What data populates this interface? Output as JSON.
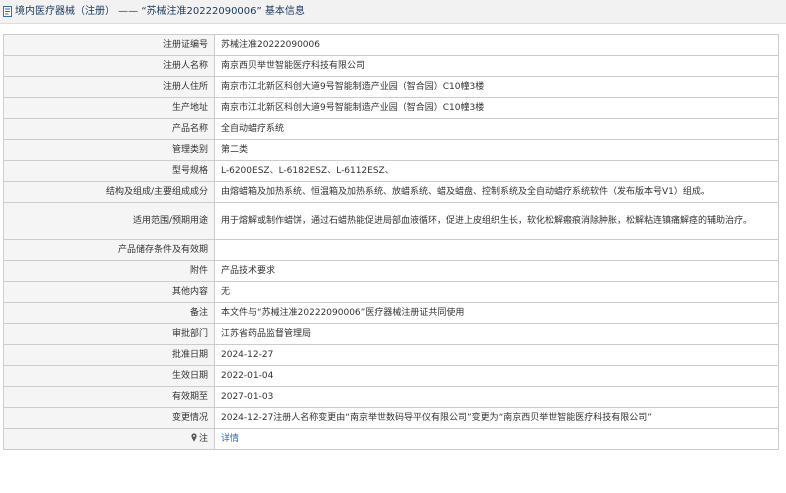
{
  "header": {
    "title": "境内医疗器械（注册） —— “苏械注准20222090006” 基本信息",
    "icon": "document-icon"
  },
  "rows": [
    {
      "label": "注册证编号",
      "value": "苏械注准20222090006"
    },
    {
      "label": "注册人名称",
      "value": "南京西贝举世智能医疗科技有限公司"
    },
    {
      "label": "注册人住所",
      "value": "南京市江北新区科创大道9号智能制造产业园（智合园）C10幢3楼"
    },
    {
      "label": "生产地址",
      "value": "南京市江北新区科创大道9号智能制造产业园（智合园）C10幢3楼"
    },
    {
      "label": "产品名称",
      "value": "全自动蜡疗系统"
    },
    {
      "label": "管理类别",
      "value": "第二类"
    },
    {
      "label": "型号规格",
      "value": "L-6200ESZ、L-6182ESZ、L-6112ESZ、"
    },
    {
      "label": "结构及组成/主要组成成分",
      "value": "由熔蜡箱及加热系统、恒温箱及加热系统、放蜡系统、蜡及蜡盘、控制系统及全自动蜡疗系统软件（发布版本号V1）组成。"
    },
    {
      "label": "适用范围/预期用途",
      "value": "用于熔解或制作蜡饼，通过石蜡热能促进局部血液循环，促进上皮组织生长，软化松解瘢痕消除肿胀，松解粘连镇痛解痉的辅助治疗。"
    },
    {
      "label": "产品储存条件及有效期",
      "value": ""
    },
    {
      "label": "附件",
      "value": "产品技术要求"
    },
    {
      "label": "其他内容",
      "value": "无"
    },
    {
      "label": "备注",
      "value": "本文件与“苏械注准20222090006”医疗器械注册证共同使用"
    },
    {
      "label": "审批部门",
      "value": "江苏省药品监督管理局"
    },
    {
      "label": "批准日期",
      "value": "2024-12-27"
    },
    {
      "label": "生效日期",
      "value": "2022-01-04"
    },
    {
      "label": "有效期至",
      "value": "2027-01-03"
    },
    {
      "label": "变更情况",
      "value": "2024-12-27注册人名称变更由“南京举世数码导平仪有限公司”变更为“南京西贝举世智能医疗科技有限公司”"
    }
  ],
  "note_row": {
    "label": "注",
    "icon": "pin-icon",
    "link_text": "详情"
  }
}
